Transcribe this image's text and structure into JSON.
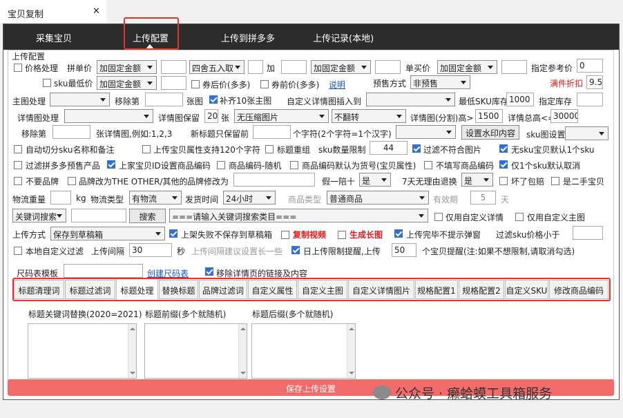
{
  "window": {
    "tab_title": "宝贝复制",
    "close": "✕"
  },
  "nav": [
    "采集宝贝",
    "上传配置",
    "上传到拼多多",
    "上传记录(本地)"
  ],
  "section_title": "上传配置",
  "row1": {
    "price_cb": "价格处理",
    "pin_label": "拼单价",
    "pin_sel": "加固定金额",
    "round_sel": "四舍五入取",
    "add": "加",
    "add_sel": "加固定金额",
    "single_label": "单买价",
    "single_sel": "加固定金额",
    "ref_label": "指定参考价",
    "ref_val": "0"
  },
  "row2": {
    "sku_cb": "sku最低价",
    "sku_sel": "加固定金额",
    "after_cb": "券后价(多多)",
    "before_cb": "券前价(多多)",
    "explain": "说明",
    "presale_label": "预售方式",
    "presale_sel": "非预售",
    "discount_label": "满件折扣",
    "discount_val": "9.5"
  },
  "row3": {
    "main_label": "主图处理",
    "remove_label": "移除第",
    "zhang": "张图",
    "fill_cb": "补齐10张主图",
    "insert_label": "自定义详情图插入到",
    "minsku_label": "最低SKU库存",
    "minsku_val": "1000",
    "stock_label": "指定库存"
  },
  "row4": {
    "detail_label": "详情图处理",
    "keep_label": "详情图保留",
    "keep_val": "20",
    "zhang": "张",
    "nocompress_sel": "无压缩图片",
    "noflip_sel": "不翻转",
    "split_label": "详情图(分割)高>",
    "split_val": "1500",
    "total_label": "详情总高<=",
    "total_val": "30000"
  },
  "row5": {
    "remove_label": "移除第",
    "example": "张详情图,例如:1,2,3",
    "newtitle_label": "新标题只保留前",
    "chars": "个字符(2个字符=1个汉字)",
    "watermark_btn": "设置水印内容",
    "skuimg_label": "sku图设置"
  },
  "row6": {
    "c1": "自动切分sku名称和备注",
    "c2": "上传宝贝属性支持120个字符",
    "c3": "标题重组",
    "sku_limit": "sku数量限制",
    "sku_limit_val": "44",
    "c4": "过滤不符合图片",
    "c5": "无sku宝贝默认1个sku"
  },
  "row7": {
    "c1": "过滤拼多多预售产品",
    "c2": "上家宝贝ID设置商品编码",
    "c3": "商品编码-随机",
    "c4": "商品编码默认为货号(宝贝属性)",
    "c5": "不填写商品编码",
    "c6": "仅1个sku默认取消"
  },
  "row8": {
    "c1": "不要品牌",
    "c2": "品牌改为THE OTHER/其他的",
    "brand_label": "品牌修改为",
    "fake_label": "假一陪十",
    "fake_sel": "是",
    "return_label": "7天无理由退换",
    "return_sel": "是",
    "c3": "坏了包赔",
    "c4": "是二手宝贝"
  },
  "row9": {
    "weight_label": "物流重量",
    "kg": "kg",
    "type_label": "物流类型",
    "type_sel": "有物流",
    "time_label": "发货时间",
    "time_sel": "24小时",
    "goods_label": "商品类型",
    "goods_sel": "普通商品",
    "valid_label": "有效期",
    "valid_val": "5",
    "day": "天"
  },
  "row10": {
    "kw_sel": "关键词搜索",
    "search_btn": "搜索",
    "category_sel": "===请输入关键词搜索类目===",
    "c1": "仅用自定义详情",
    "c2": "仅用自定义主图"
  },
  "row11": {
    "method_label": "上传方式",
    "method_sel": "保存到草稿箱",
    "c1": "上架失败不保存到草稿箱",
    "c2": "复制视频",
    "c3": "生成长图",
    "c4": "上传完毕不提示弹窗",
    "filter_label": "过滤sku价格小于"
  },
  "row12": {
    "c1": "本地自定义过滤",
    "interval_label": "上传间隔",
    "interval_val": "30",
    "sec": "秒",
    "hint": "上传间隔建议设置长一些",
    "c2": "日上传限制提醒,上传",
    "limit_val": "50",
    "limit_note": "个宝贝提醒(注:如果不想限制,请取消勾选)"
  },
  "row13": {
    "size_label": "尺码表模板",
    "create_link": "创建尺码表",
    "c1": "移除详情页的链接及内容"
  },
  "subtabs": [
    "标题清理词",
    "标题过滤词",
    "标题处理",
    "替换标题",
    "品牌过滤词",
    "自定义属性",
    "自定义主图",
    "自定义详情图片",
    "规格配置1",
    "规格配置2",
    "自定义SKU",
    "修改商品编码"
  ],
  "title_panel": {
    "kw_replace": "标题关键词替换(2020=2021)",
    "prefix": "标题前缀(多个就随机)",
    "suffix": "标题后缀(多个就随机)"
  },
  "save_btn": "保存上传设置",
  "watermark": "公众号 · 癞蛤蟆工具箱服务"
}
